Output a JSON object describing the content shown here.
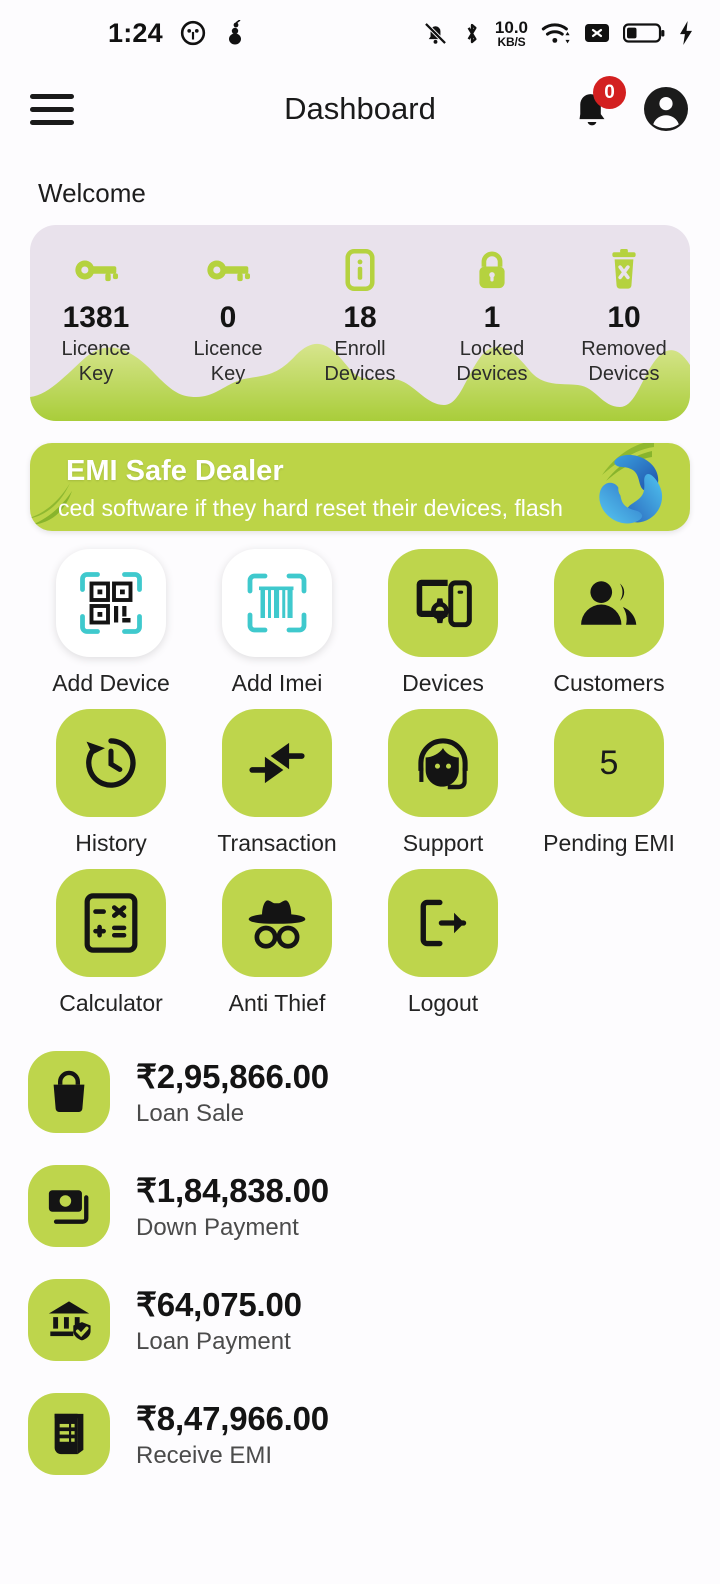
{
  "statusbar": {
    "time": "1:24",
    "network_speed_value": "10.0",
    "network_speed_unit": "KB/S",
    "icons_left": [
      "game-app-icon",
      "ant-app-icon"
    ],
    "icons_right": [
      "bell-off-icon",
      "bluetooth-icon",
      "network-speed",
      "wifi-icon",
      "x-badge-icon",
      "battery-icon",
      "charging-bolt-icon"
    ]
  },
  "appbar": {
    "menu_icon": "hamburger-menu-icon",
    "title": "Dashboard",
    "notification_icon": "bell-icon",
    "notification_count": "0",
    "profile_icon": "account-avatar-icon"
  },
  "welcome": {
    "text": "Welcome"
  },
  "stats": [
    {
      "value": "1381",
      "label_line1": "Licence",
      "label_line2": "Key",
      "icon": "key-icon"
    },
    {
      "value": "0",
      "label_line1": "Licence",
      "label_line2": "Key",
      "icon": "key-icon"
    },
    {
      "value": "18",
      "label_line1": "Enroll",
      "label_line2": "Devices",
      "icon": "phone-info-icon"
    },
    {
      "value": "1",
      "label_line1": "Locked",
      "label_line2": "Devices",
      "icon": "lock-icon"
    },
    {
      "value": "10",
      "label_line1": "Removed",
      "label_line2": "Devices",
      "icon": "trash-x-icon"
    }
  ],
  "banner": {
    "title": "EMI Safe Dealer",
    "marquee_text": "ced software if they hard reset their devices, flash softw",
    "logo": "swirl-logo-icon"
  },
  "tiles": [
    {
      "label": "Add Device",
      "icon": "qr-scan-icon",
      "style": "white",
      "badge": ""
    },
    {
      "label": "Add Imei",
      "icon": "barcode-scan-icon",
      "style": "white",
      "badge": ""
    },
    {
      "label": "Devices",
      "icon": "devices-icon",
      "style": "green",
      "badge": ""
    },
    {
      "label": "Customers",
      "icon": "customers-icon",
      "style": "green",
      "badge": ""
    },
    {
      "label": "History",
      "icon": "history-clock-icon",
      "style": "green",
      "badge": ""
    },
    {
      "label": "Transaction",
      "icon": "transfer-arrows-icon",
      "style": "green",
      "badge": ""
    },
    {
      "label": "Support",
      "icon": "headset-icon",
      "style": "green",
      "badge": ""
    },
    {
      "label": "Pending EMI",
      "icon": "number-badge",
      "style": "green",
      "badge": "5"
    },
    {
      "label": "Calculator",
      "icon": "calculator-icon",
      "style": "green",
      "badge": ""
    },
    {
      "label": "Anti Thief",
      "icon": "detective-icon",
      "style": "green",
      "badge": ""
    },
    {
      "label": "Logout",
      "icon": "logout-icon",
      "style": "green",
      "badge": ""
    }
  ],
  "money": [
    {
      "amount": "₹2,95,866.00",
      "label": "Loan Sale",
      "icon": "shopping-bag-icon"
    },
    {
      "amount": "₹1,84,838.00",
      "label": "Down Payment",
      "icon": "cash-icon"
    },
    {
      "amount": "₹64,075.00",
      "label": "Loan Payment",
      "icon": "bank-shield-icon"
    },
    {
      "amount": "₹8,47,966.00",
      "label": "Receive EMI",
      "icon": "receipt-icon"
    }
  ],
  "colors": {
    "accent_green": "#bed54c",
    "card_lavender": "#e9e2ec",
    "badge_red": "#d32020",
    "scan_cyan": "#3fc9cd",
    "page_bg": "#fdfcfe"
  }
}
